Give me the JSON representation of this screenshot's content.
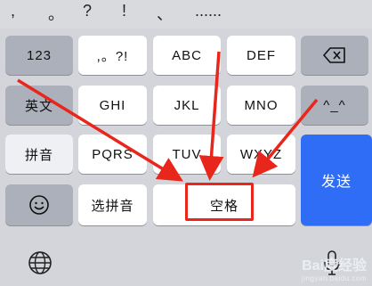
{
  "candidates": [
    ",",
    "。",
    "?",
    "!",
    "、",
    "......"
  ],
  "keys": {
    "k123": "123",
    "punct": ",。?!",
    "abc": "ABC",
    "def": "DEF",
    "english": "英文",
    "ghi": "GHI",
    "jkl": "JKL",
    "mno": "MNO",
    "emoticon": "^_^",
    "pinyin": "拼音",
    "pqrs": "PQRS",
    "tuv": "TUV",
    "wxyz": "WXYZ",
    "send": "发送",
    "select_pinyin": "选拼音",
    "space": "空格"
  },
  "icons": {
    "delete": "backspace-icon",
    "emoji": "emoji-icon",
    "globe": "globe-icon",
    "mic": "microphone-icon"
  },
  "annotation_color": "#e8261c",
  "accent_color": "#2f6df6",
  "watermark": {
    "brand": "Bai度经验",
    "url": "jingyan.baidu.com"
  }
}
